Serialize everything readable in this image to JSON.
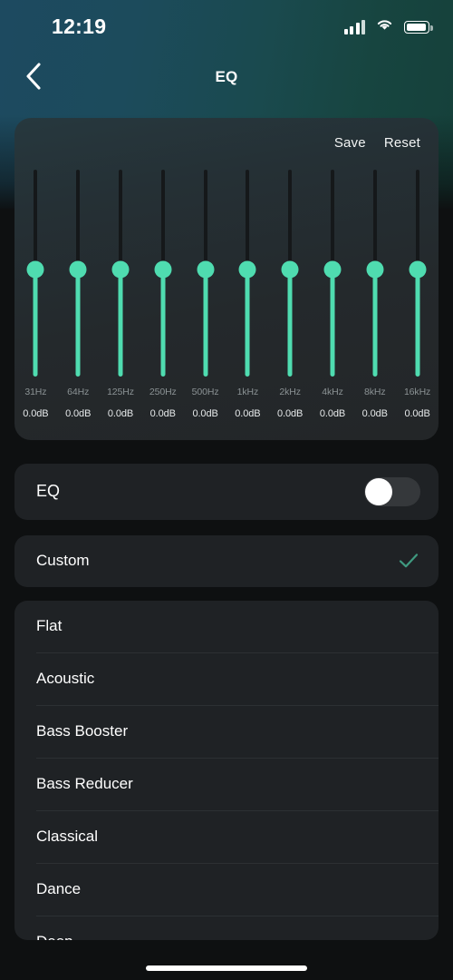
{
  "colors": {
    "accent": "#4fdcb0",
    "check": "#3f9a80",
    "card_bg": "#1f2225",
    "text": "#ffffff",
    "muted": "#8b9294",
    "gradient_left": "#1d4a60",
    "gradient_right": "#15403a"
  },
  "status_bar": {
    "time": "12:19",
    "signal_icon": "cellular-signal-icon",
    "wifi_icon": "wifi-icon",
    "battery_icon": "battery-icon"
  },
  "nav": {
    "back_icon": "chevron-left-icon",
    "title": "EQ"
  },
  "eq_card": {
    "save_label": "Save",
    "reset_label": "Reset",
    "bands": [
      {
        "freq": "31Hz",
        "gain": "0.0dB",
        "value": 0
      },
      {
        "freq": "64Hz",
        "gain": "0.0dB",
        "value": 0
      },
      {
        "freq": "125Hz",
        "gain": "0.0dB",
        "value": 0
      },
      {
        "freq": "250Hz",
        "gain": "0.0dB",
        "value": 0
      },
      {
        "freq": "500Hz",
        "gain": "0.0dB",
        "value": 0
      },
      {
        "freq": "1kHz",
        "gain": "0.0dB",
        "value": 0
      },
      {
        "freq": "2kHz",
        "gain": "0.0dB",
        "value": 0
      },
      {
        "freq": "4kHz",
        "gain": "0.0dB",
        "value": 0
      },
      {
        "freq": "8kHz",
        "gain": "0.0dB",
        "value": 0
      },
      {
        "freq": "16kHz",
        "gain": "0.0dB",
        "value": 0
      }
    ]
  },
  "eq_toggle": {
    "label": "EQ",
    "state": "off"
  },
  "custom_preset": {
    "label": "Custom",
    "selected": true,
    "check_icon": "checkmark-icon"
  },
  "presets": [
    {
      "label": "Flat"
    },
    {
      "label": "Acoustic"
    },
    {
      "label": "Bass Booster"
    },
    {
      "label": "Bass Reducer"
    },
    {
      "label": "Classical"
    },
    {
      "label": "Dance"
    },
    {
      "label": "Deep"
    }
  ],
  "home_indicator": "home-indicator"
}
